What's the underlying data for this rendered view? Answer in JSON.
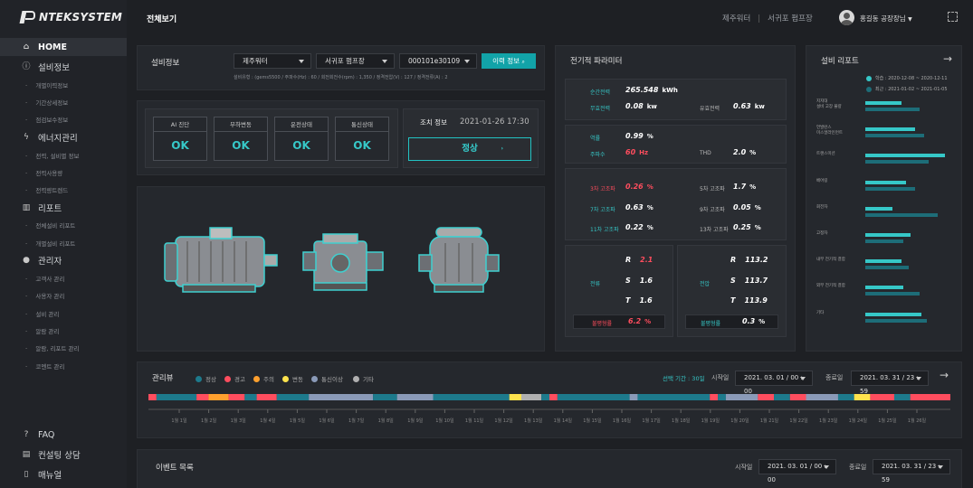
{
  "brand": "NTEKSYSTEM",
  "sidebar": {
    "home": "HOME",
    "equip": "설비정보",
    "equip_subs": [
      "개별이력정보",
      "기간상세정보",
      "점검보수정보"
    ],
    "energy": "에너지관리",
    "energy_subs": [
      "전력, 설비별 정보",
      "전력사용량",
      "전력량트렌드"
    ],
    "report": "리포트",
    "report_subs": [
      "전체설비 리포트",
      "개별설비 리포트"
    ],
    "admin": "관리자",
    "admin_subs": [
      "고객사 관리",
      "사용자 관리",
      "설비 관리",
      "알람 관리",
      "알람, 리포트 관리",
      "코멘트 관리"
    ],
    "faq": "FAQ",
    "consult": "컨설팅 상담",
    "manual": "매뉴얼"
  },
  "header": {
    "title": "전체보기",
    "site1": "제주워터",
    "site2": "서귀포 펌프장",
    "user": "홍길동 공장장님"
  },
  "equip_info": {
    "title": "설비정보",
    "dd1": "제주워터",
    "dd2": "서귀포 펌프장",
    "dd3": "000101e30109",
    "history_btn": "이력 정보",
    "spec": "설비유형 : (gems5500 / 주파수(Hz) : 60 / 회전회전수(rpm) : 1,350 / 정격전압(V) : 127 / 정격전류(A) : 2"
  },
  "status": [
    {
      "label": "AI 진단",
      "value": "OK"
    },
    {
      "label": "부하변동",
      "value": "OK"
    },
    {
      "label": "운전상태",
      "value": "OK"
    },
    {
      "label": "통신상태",
      "value": "OK"
    }
  ],
  "action": {
    "label": "조치 정보",
    "date": "2021-01-26 17:30",
    "button": "정상"
  },
  "params": {
    "title": "전기적 파라미터",
    "rows": [
      {
        "k": "순간전력",
        "v": "265.548",
        "u": "kWh"
      },
      {
        "k": "무효전력",
        "v": "0.08",
        "u": "kw"
      },
      {
        "k": "유효전력",
        "v": "0.63",
        "u": "kw"
      },
      {
        "k": "역률",
        "v": "0.99",
        "u": "%"
      },
      {
        "k": "주파수",
        "v": "60",
        "u": "Hz"
      },
      {
        "k": "THD",
        "v": "2.0",
        "u": "%"
      },
      {
        "k": "3차 고조파",
        "v": "0.26",
        "u": "%"
      },
      {
        "k": "5차 고조파",
        "v": "1.7",
        "u": "%"
      },
      {
        "k": "7차 고조파",
        "v": "0.63",
        "u": "%"
      },
      {
        "k": "9차 고조파",
        "v": "0.05",
        "u": "%"
      },
      {
        "k": "11차 고조파",
        "v": "0.22",
        "u": "%"
      },
      {
        "k": "13차 고조파",
        "v": "0.25",
        "u": "%"
      }
    ],
    "current": {
      "label": "전류",
      "r": "2.1",
      "s": "1.6",
      "t": "1.6",
      "unbalance_label": "불평형률",
      "unbalance": "6.2",
      "unit": "%"
    },
    "voltage": {
      "label": "전압",
      "r": "113.2",
      "s": "113.7",
      "t": "113.9",
      "unbalance_label": "불평형률",
      "unbalance": "0.3",
      "unit": "%"
    },
    "phase": {
      "r": "R",
      "s": "S",
      "t": "T"
    }
  },
  "report": {
    "title": "설비 리포트",
    "legend_learn": "학습 : 2020-12-08 ~ 2020-12-11",
    "legend_recent": "최근 : 2021-01-02 ~ 2021-01-05",
    "items": [
      {
        "label": "지지대\n설비 고장 불량",
        "a": 40,
        "b": 60
      },
      {
        "label": "언발런스\n미스얼라인먼트",
        "a": 55,
        "b": 65
      },
      {
        "label": "트랜스미션",
        "a": 88,
        "b": 70
      },
      {
        "label": "베어링",
        "a": 45,
        "b": 55
      },
      {
        "label": "회전자",
        "a": 30,
        "b": 80
      },
      {
        "label": "고정자",
        "a": 50,
        "b": 42
      },
      {
        "label": "내부 전기적 결함",
        "a": 40,
        "b": 48
      },
      {
        "label": "외부 전기적 결함",
        "a": 42,
        "b": 60
      },
      {
        "label": "기타",
        "a": 62,
        "b": 68
      }
    ]
  },
  "timeline": {
    "title": "관리뷰",
    "legend": [
      {
        "name": "정상",
        "color": "#1d7a8c"
      },
      {
        "name": "경고",
        "color": "#ff4d5e"
      },
      {
        "name": "주의",
        "color": "#ffa02e"
      },
      {
        "name": "변동",
        "color": "#ffe34d"
      },
      {
        "name": "통신이상",
        "color": "#8a9ab8"
      },
      {
        "name": "기타",
        "color": "#b0b0b0"
      }
    ],
    "period": "선택 기간 : 30일",
    "start_label": "시작일",
    "start": "2021. 03. 01 / 00 : 00",
    "end_label": "종료일",
    "end": "2021. 03. 31 / 23 : 59",
    "days": [
      "1월 1일",
      "1월 2일",
      "1월 3일",
      "1월 4일",
      "1월 5일",
      "1월 6일",
      "1월 7일",
      "1월 8일",
      "1월 9일",
      "1월 10일",
      "1월 11일",
      "1월 12일",
      "1월 13일",
      "1월 14일",
      "1월 15일",
      "1월 16일",
      "1월 17일",
      "1월 18일",
      "1월 19일",
      "1월 20일",
      "1월 21일",
      "1월 22일",
      "1월 23일",
      "1월 24일",
      "1월 25일",
      "1월 26일"
    ]
  },
  "events": {
    "title": "이벤트 목록",
    "start_label": "시작일",
    "start": "2021. 03. 01 / 00 : 00",
    "end_label": "종료일",
    "end": "2021. 03. 31 / 23 : 59"
  }
}
